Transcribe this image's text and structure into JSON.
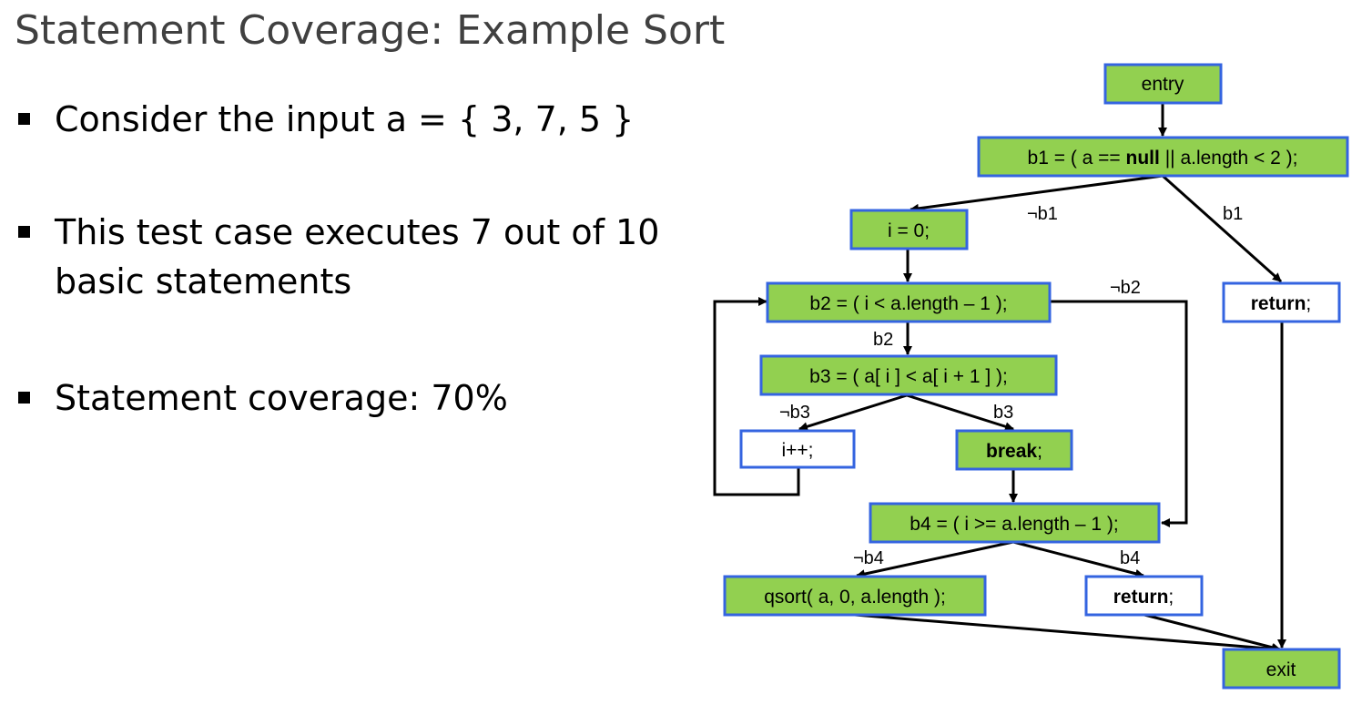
{
  "slide": {
    "title": "Statement Coverage: Example Sort",
    "bullets": [
      "Consider the input a = { 3, 7, 5 }",
      "This test case executes 7 out of 10 basic statements",
      "Statement coverage: 70%"
    ]
  },
  "colors": {
    "covered_fill": "#92d050",
    "uncovered_fill": "#ffffff",
    "node_border": "#3464e0",
    "title_text": "#404040"
  },
  "flowgraph": {
    "nodes": {
      "entry": {
        "text": "entry",
        "covered": true
      },
      "b1": {
        "pre": "b1 = ( a == ",
        "bold": "null",
        "post": " || a.length < 2 );",
        "covered": true
      },
      "i0": {
        "text": "i = 0;",
        "covered": true
      },
      "ret1": {
        "bold": "return",
        "post": ";",
        "covered": false
      },
      "b2": {
        "text": "b2 = ( i < a.length – 1 );",
        "covered": true
      },
      "b3": {
        "text": "b3 = ( a[ i ] < a[ i + 1 ] );",
        "covered": true
      },
      "inc": {
        "text": "i++;",
        "covered": false
      },
      "brk": {
        "bold": "break",
        "post": ";",
        "covered": true
      },
      "b4": {
        "text": "b4 = ( i >= a.length – 1 );",
        "covered": true
      },
      "qsort": {
        "text": "qsort( a, 0, a.length );",
        "covered": true
      },
      "ret2": {
        "bold": "return",
        "post": ";",
        "covered": false
      },
      "exit": {
        "text": "exit",
        "covered": true
      }
    },
    "edge_labels": {
      "not_b1": "¬b1",
      "b1": "b1",
      "not_b2": "¬b2",
      "b2": "b2",
      "not_b3": "¬b3",
      "b3": "b3",
      "not_b4": "¬b4",
      "b4": "b4"
    }
  }
}
